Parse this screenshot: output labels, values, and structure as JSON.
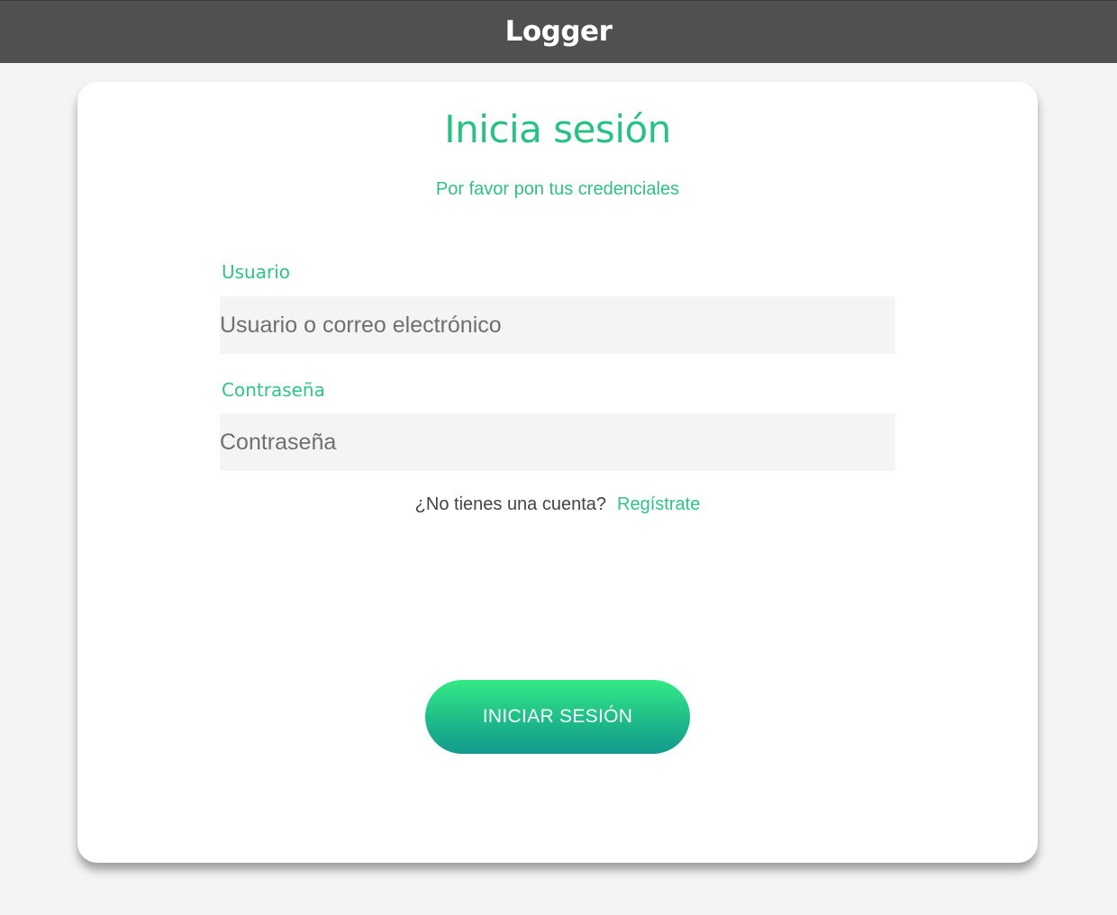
{
  "header": {
    "brand": "Logger"
  },
  "login": {
    "title": "Inicia sesión",
    "subtitle": "Por favor pon tus credenciales",
    "username": {
      "label": "Usuario",
      "placeholder": "Usuario o correo electrónico",
      "value": ""
    },
    "password": {
      "label": "Contraseña",
      "placeholder": "Contraseña",
      "value": ""
    },
    "register_question": "¿No tienes una cuenta?",
    "register_link": "Regístrate",
    "submit_label": "INICIAR SESIÓN"
  },
  "colors": {
    "accent": "#27c283",
    "header_bg": "#505050",
    "page_bg": "#f4f4f4",
    "button_gradient_top": "#35ea85",
    "button_gradient_bottom": "#139a8d"
  }
}
